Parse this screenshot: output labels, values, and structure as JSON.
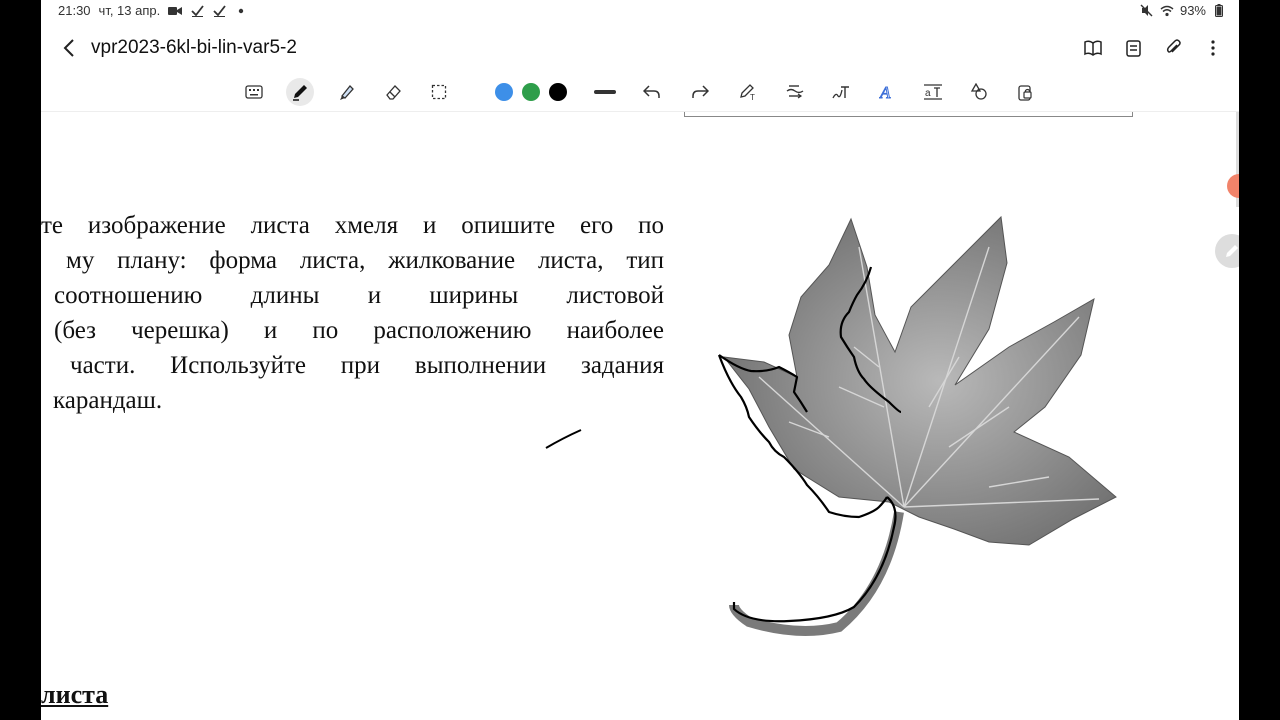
{
  "status": {
    "time": "21:30",
    "date": "чт, 13 апр.",
    "battery": "93%",
    "icons": [
      "video-camera-icon",
      "check-icon",
      "check-icon",
      "dot-icon",
      "mute-icon",
      "wifi-icon",
      "battery-icon"
    ]
  },
  "header": {
    "title": "vpr2023-6kl-bi-lin-var5-2",
    "actions": [
      "book-view-icon",
      "page-list-icon",
      "attachment-icon",
      "more-vertical-icon"
    ]
  },
  "toolbar": {
    "tools": [
      "keyboard-icon",
      "pen-icon",
      "highlighter-icon",
      "eraser-icon",
      "lasso-select-icon"
    ],
    "active_tool": "pen-icon",
    "colors": [
      "#3d8fe8",
      "#2e9e4a",
      "#000000"
    ],
    "selected_color": "#000000",
    "actions": [
      "stroke-width-icon",
      "undo-icon",
      "redo-icon",
      "pen-to-text-icon",
      "text-straighten-icon",
      "handwriting-icon",
      "text-style-icon",
      "text-format-icon",
      "shapes-icon",
      "lock-icon"
    ]
  },
  "document": {
    "task_lines": [
      "те изображение листа хмеля и опишите его по",
      "му плану: форма листа, жилкование листа, тип",
      "соотношению длины и ширины листовой",
      "(без черешка) и по расположению наиболее",
      "части. Используйте при выполнении задания",
      "карандаш."
    ],
    "section_heading": "листа"
  }
}
